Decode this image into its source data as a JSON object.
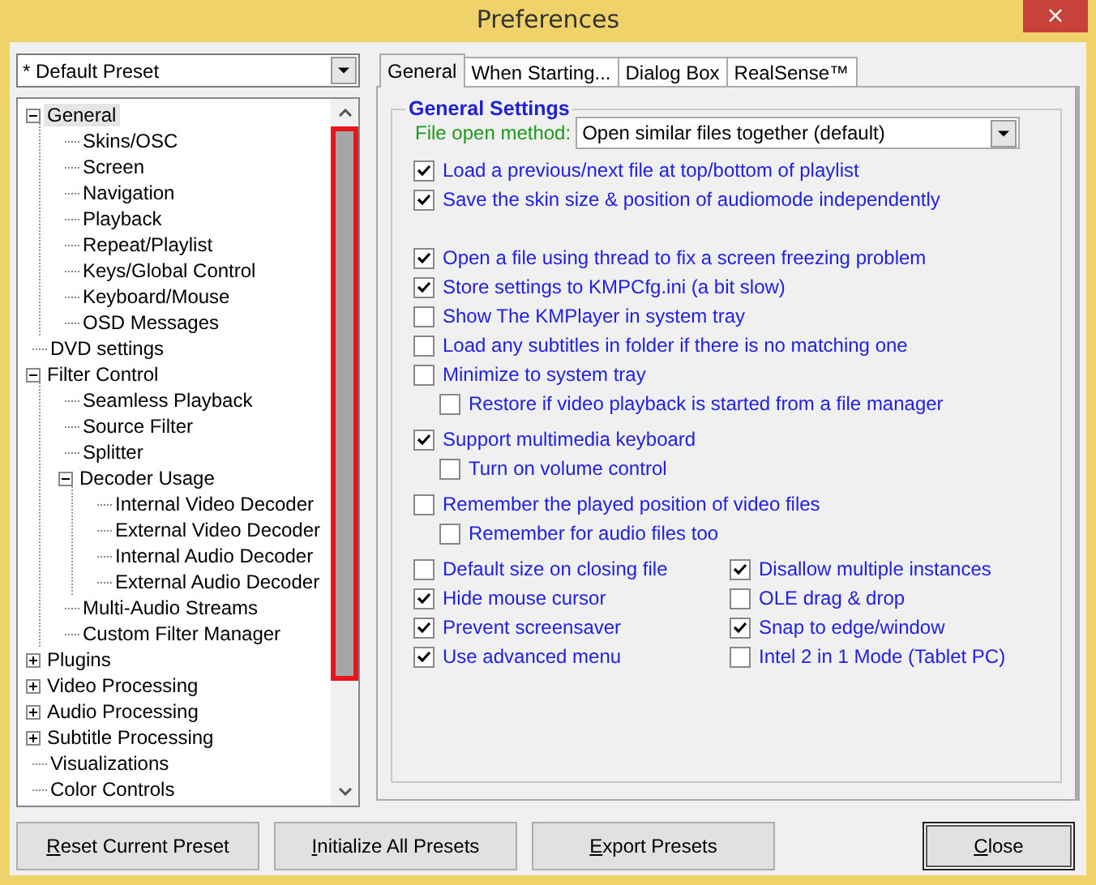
{
  "window": {
    "title": "Preferences",
    "close": "×"
  },
  "preset": {
    "value": "* Default Preset"
  },
  "tree": [
    {
      "label": "General",
      "selected": true,
      "expanded": true,
      "children": [
        {
          "label": "Skins/OSC"
        },
        {
          "label": "Screen"
        },
        {
          "label": "Navigation"
        },
        {
          "label": "Playback"
        },
        {
          "label": "Repeat/Playlist"
        },
        {
          "label": "Keys/Global Control"
        },
        {
          "label": "Keyboard/Mouse"
        },
        {
          "label": "OSD Messages"
        }
      ]
    },
    {
      "label": "DVD settings"
    },
    {
      "label": "Filter Control",
      "expanded": true,
      "children": [
        {
          "label": "Seamless Playback"
        },
        {
          "label": "Source Filter"
        },
        {
          "label": "Splitter"
        },
        {
          "label": "Decoder Usage",
          "expanded": true,
          "children": [
            {
              "label": "Internal Video Decoder"
            },
            {
              "label": "External Video Decoder"
            },
            {
              "label": "Internal Audio Decoder"
            },
            {
              "label": "External Audio Decoder"
            }
          ]
        },
        {
          "label": "Multi-Audio Streams"
        },
        {
          "label": "Custom Filter Manager"
        }
      ]
    },
    {
      "label": "Plugins",
      "expanded": false
    },
    {
      "label": "Video Processing",
      "expanded": false
    },
    {
      "label": "Audio Processing",
      "expanded": false
    },
    {
      "label": "Subtitle Processing",
      "expanded": false
    },
    {
      "label": "Visualizations"
    },
    {
      "label": "Color Controls"
    }
  ],
  "tabs": [
    {
      "label": "General",
      "selected": true
    },
    {
      "label": "When Starting...",
      "selected": false
    },
    {
      "label": "Dialog Box",
      "selected": false
    },
    {
      "label": "RealSense™",
      "selected": false
    }
  ],
  "general_settings": {
    "title": "General Settings",
    "file_open_method": {
      "label": "File open method:",
      "value": "Open similar files together (default)"
    },
    "groups": [
      [
        {
          "label": "Load a previous/next file at top/bottom of playlist",
          "checked": true
        },
        {
          "label": "Save the skin size & position of audiomode independently",
          "checked": true
        }
      ],
      [
        {
          "label": "Open a file using thread to fix a screen freezing problem",
          "checked": true
        },
        {
          "label": "Store settings to KMPCfg.ini (a bit slow)",
          "checked": true
        },
        {
          "label": "Show The KMPlayer in system tray",
          "checked": false
        },
        {
          "label": "Load any subtitles in folder if there is no matching one",
          "checked": false
        },
        {
          "label": "Minimize to system tray",
          "checked": false,
          "children": [
            {
              "label": "Restore if video playback is started from a file manager",
              "checked": false
            }
          ]
        }
      ],
      [
        {
          "label": "Support multimedia keyboard",
          "checked": true,
          "children": [
            {
              "label": "Turn on volume control",
              "checked": false
            }
          ]
        }
      ],
      [
        {
          "label": "Remember the played position of video files",
          "checked": false,
          "children": [
            {
              "label": "Remember for audio files too",
              "checked": false
            }
          ]
        }
      ]
    ],
    "columns": [
      [
        {
          "label": "Default size on closing file",
          "checked": false
        },
        {
          "label": "Hide mouse cursor",
          "checked": true
        },
        {
          "label": "Prevent screensaver",
          "checked": true
        },
        {
          "label": "Use advanced menu",
          "checked": true
        }
      ],
      [
        {
          "label": "Disallow multiple instances",
          "checked": true
        },
        {
          "label": "OLE drag & drop",
          "checked": false
        },
        {
          "label": "Snap to edge/window",
          "checked": true
        },
        {
          "label": "Intel 2 in 1 Mode (Tablet PC)",
          "checked": false
        }
      ]
    ]
  },
  "buttons": [
    {
      "label": "Reset Current Preset",
      "default": false
    },
    {
      "label": "Initialize All Presets",
      "default": false
    },
    {
      "label": "Export Presets",
      "default": false
    },
    {
      "label": "Close",
      "default": true
    }
  ]
}
